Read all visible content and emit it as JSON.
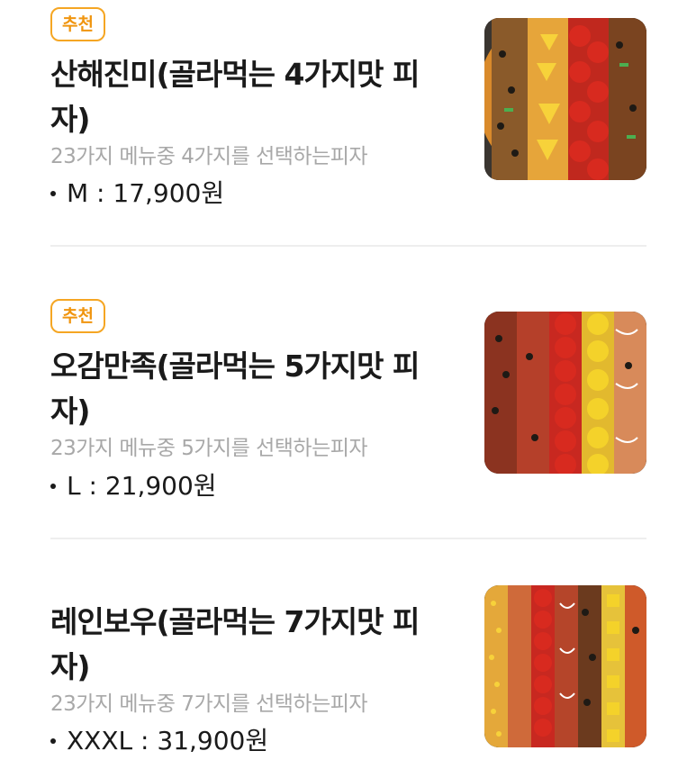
{
  "menu": {
    "items": [
      {
        "badge": "추천",
        "title": "산해진미(골라먹는 4가지맛 피자)",
        "description": "23가지 메뉴중 4가지를 선택하는피자",
        "price": "M : 17,900원",
        "image_icon": "pizza-image"
      },
      {
        "badge": "추천",
        "title": "오감만족(골라먹는 5가지맛 피자)",
        "description": "23가지 메뉴중 5가지를 선택하는피자",
        "price": "L : 21,900원",
        "image_icon": "pizza-image"
      },
      {
        "title": "레인보우(골라먹는 7가지맛 피자)",
        "description": "23가지 메뉴중 7가지를 선택하는피자",
        "price": "XXXL : 31,900원",
        "image_icon": "pizza-image"
      }
    ]
  },
  "colors": {
    "badge_border": "#f5a623",
    "badge_text": "#f0950f",
    "title_text": "#1a1a1a",
    "description_text": "#a8a8a8",
    "divider": "#eeeeee"
  }
}
